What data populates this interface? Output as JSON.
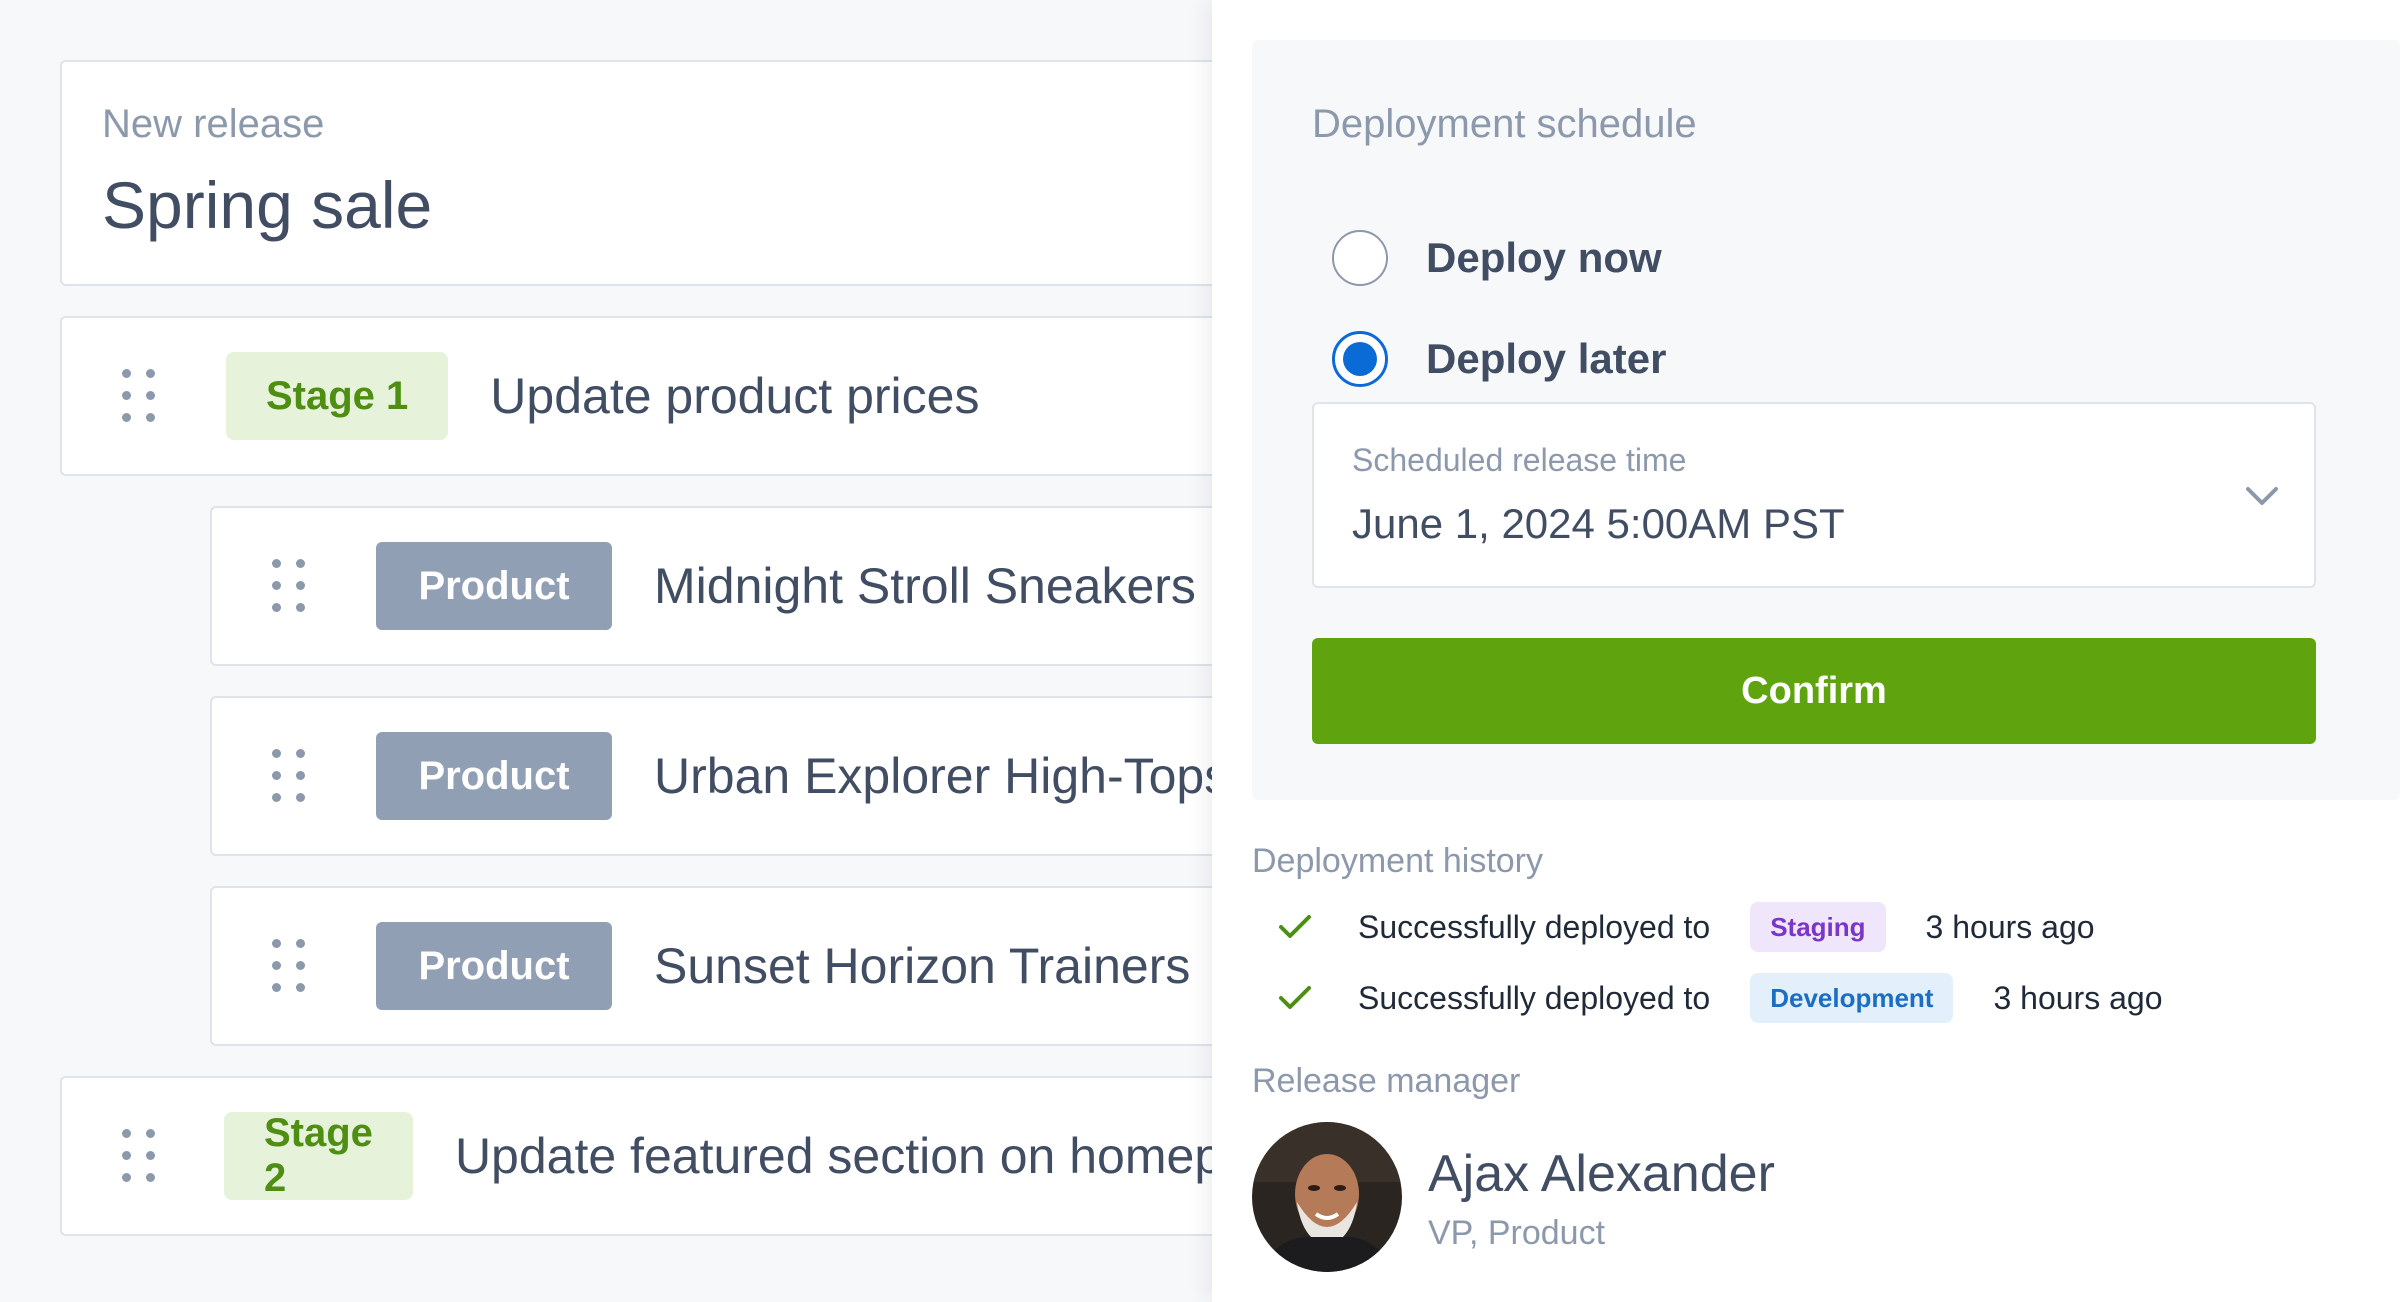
{
  "release": {
    "label": "New release",
    "title": "Spring sale"
  },
  "items": {
    "stage1": {
      "badge": "Stage 1",
      "title": "Update product prices"
    },
    "product1": {
      "badge": "Product",
      "title": "Midnight Stroll Sneakers"
    },
    "product2": {
      "badge": "Product",
      "title": "Urban Explorer High-Tops"
    },
    "product3": {
      "badge": "Product",
      "title": "Sunset Horizon Trainers"
    },
    "stage2": {
      "badge": "Stage 2",
      "title": "Update featured section on homepage"
    }
  },
  "schedule": {
    "heading": "Deployment schedule",
    "option_now": "Deploy now",
    "option_later": "Deploy later",
    "selected": "Deploy later",
    "field_label": "Scheduled release time",
    "field_value": "June 1, 2024 5:00AM PST",
    "confirm_label": "Confirm"
  },
  "history": {
    "heading": "Deployment history",
    "entries": [
      {
        "text": "Successfully deployed to",
        "env": "Staging",
        "time": "3 hours ago"
      },
      {
        "text": "Successfully deployed to",
        "env": "Development",
        "time": "3 hours ago"
      }
    ]
  },
  "manager": {
    "heading": "Release manager",
    "name": "Ajax Alexander",
    "role": "VP, Product"
  },
  "colors": {
    "confirm": "#5fa40f",
    "radio_selected": "#0b6bd6",
    "stage_badge_bg": "#e6f2d9",
    "product_badge_bg": "#919fb5",
    "staging_badge": "#7b35c9",
    "development_badge": "#1a6fc4"
  }
}
